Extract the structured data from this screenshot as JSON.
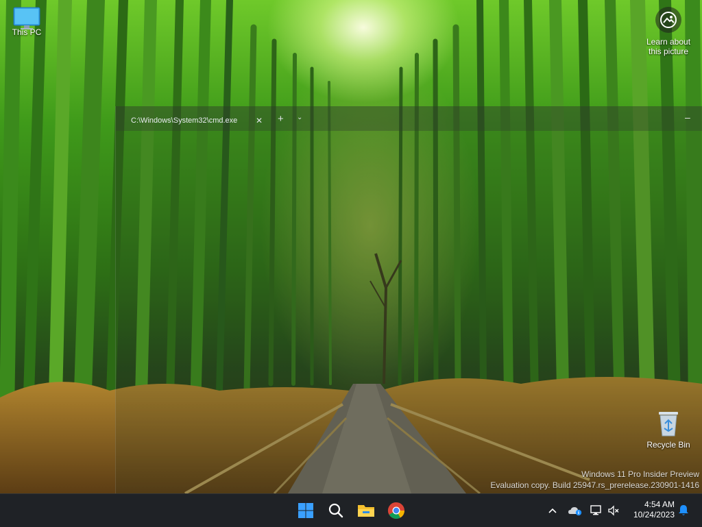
{
  "desktop": {
    "this_pc_label": "This PC",
    "recycle_bin_label": "Recycle Bin",
    "learn_line1": "Learn about",
    "learn_line2": "this picture",
    "wallpaper": "bamboo-forest-path"
  },
  "terminal": {
    "tab_title": "C:\\Windows\\System32\\cmd.exe",
    "close_glyph": "✕",
    "new_tab_glyph": "+",
    "dropdown_glyph": "⌄",
    "minimize_glyph": "–"
  },
  "watermark": {
    "line1": "Windows 11 Pro Insider Preview",
    "line2": "Evaluation copy. Build 25947.rs_prerelease.230901-1416"
  },
  "taskbar": {
    "apps": [
      "start-icon",
      "search-icon",
      "file-explorer-icon",
      "chrome-icon"
    ],
    "tray_icons": [
      "chevron-up-icon",
      "onedrive-icon",
      "network-icon",
      "volume-muted-icon",
      "notification-bell-icon"
    ],
    "time": "4:54 AM",
    "date": "10/24/2023"
  },
  "colors": {
    "taskbar_bg": "#1f2226",
    "accent_blue": "#1e90ff",
    "folder_yellow": "#f4c02e"
  }
}
